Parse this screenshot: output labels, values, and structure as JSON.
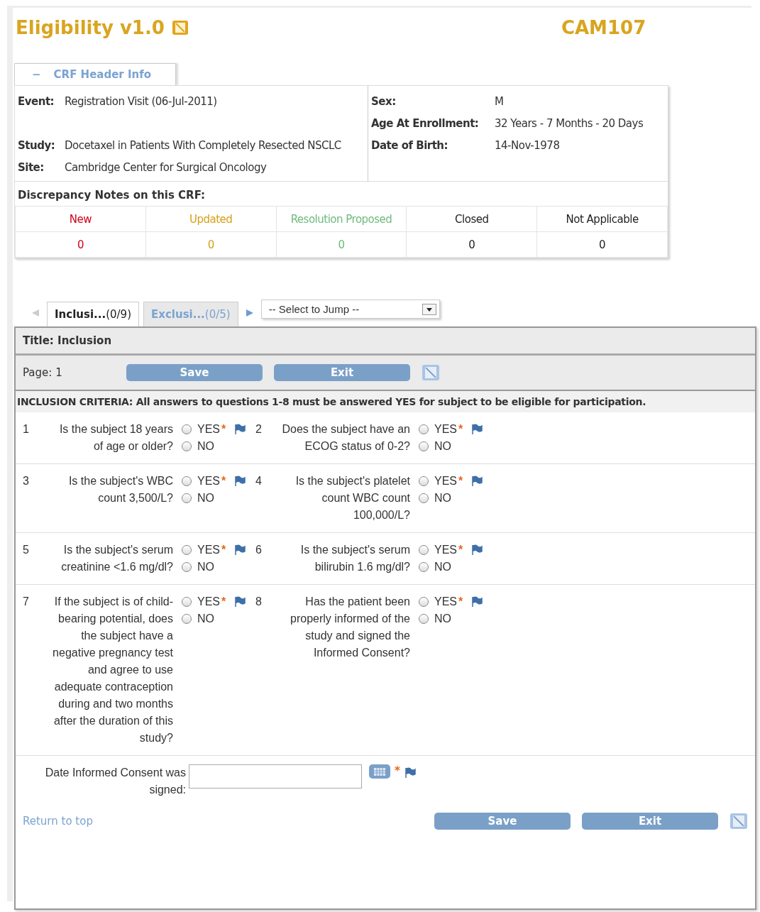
{
  "header": {
    "title": "Eligibility v1.0",
    "subject_id": "CAM107"
  },
  "crf_header": {
    "toggle": "−",
    "label": "CRF Header Info",
    "expanded": true,
    "left_fields": [
      {
        "label": "Event:",
        "value": "Registration Visit (06-Jul-2011)"
      },
      {
        "label": "Study:",
        "value": "Docetaxel in Patients With Completely Resected NSCLC"
      },
      {
        "label": "Site:",
        "value": "Cambridge Center for Surgical Oncology"
      }
    ],
    "right_fields": [
      {
        "label": "Sex:",
        "value": "M"
      },
      {
        "label": "Age At Enrollment:",
        "value": "32 Years - 7 Months - 20 Days"
      },
      {
        "label": "Date of Birth:",
        "value": "14-Nov-1978"
      }
    ],
    "notes_title": "Discrepancy Notes on this CRF:",
    "notes": [
      {
        "label": "New",
        "count": "0",
        "color": "#d0021b"
      },
      {
        "label": "Updated",
        "count": "0",
        "color": "#d4a017"
      },
      {
        "label": "Resolution Proposed",
        "count": "0",
        "color": "#6dbb7a"
      },
      {
        "label": "Closed",
        "count": "0",
        "color": "#222222"
      },
      {
        "label": "Not Applicable",
        "count": "0",
        "color": "#222222"
      }
    ]
  },
  "tabs": [
    {
      "label": "Inclusi...",
      "count": "(0/9)",
      "selected": true
    },
    {
      "label": "Exclusi...",
      "count": "(0/5)",
      "selected": false
    }
  ],
  "jump_select": {
    "value": "-- Select to Jump --"
  },
  "section": {
    "title": "Title: Inclusion",
    "page": "Page: 1",
    "save": "Save",
    "exit": "Exit",
    "instructions": "INCLUSION CRITERIA: All answers to questions 1-8 must be answered YES for subject to be eligible for participation.",
    "questions": [
      {
        "number": "1",
        "text": "Is the subject 18 years of age or older?",
        "required": "*",
        "options": [
          {
            "label": "YES",
            "checked": false
          },
          {
            "label": "NO",
            "checked": false
          }
        ]
      },
      {
        "number": "2",
        "text": "Does the subject have an ECOG status of 0-2?",
        "required": "*",
        "options": [
          {
            "label": "YES",
            "checked": false
          },
          {
            "label": "NO",
            "checked": false
          }
        ]
      },
      {
        "number": "3",
        "text": "Is the subject's WBC count 3,500/L?",
        "required": "*",
        "options": [
          {
            "label": "YES",
            "checked": false
          },
          {
            "label": "NO",
            "checked": false
          }
        ]
      },
      {
        "number": "4",
        "text": "Is the subject's platelet count WBC count 100,000/L?",
        "required": "*",
        "options": [
          {
            "label": "YES",
            "checked": false
          },
          {
            "label": "NO",
            "checked": false
          }
        ]
      },
      {
        "number": "5",
        "text": "Is the subject's serum creatinine <1.6 mg/dl?",
        "required": "*",
        "options": [
          {
            "label": "YES",
            "checked": false
          },
          {
            "label": "NO",
            "checked": false
          }
        ]
      },
      {
        "number": "6",
        "text": "Is the subject's serum bilirubin 1.6 mg/dl?",
        "required": "*",
        "options": [
          {
            "label": "YES",
            "checked": false
          },
          {
            "label": "NO",
            "checked": false
          }
        ]
      },
      {
        "number": "7",
        "text": "If the subject is of child-bearing potential, does the subject have a negative pregnancy test and agree to use adequate contraception during and two months after the duration of this study?",
        "required": "*",
        "options": [
          {
            "label": "YES",
            "checked": false
          },
          {
            "label": "NO",
            "checked": false
          }
        ]
      },
      {
        "number": "8",
        "text": "Has the patient been properly informed of the study and signed the Informed Consent?",
        "required": "*",
        "options": [
          {
            "label": "YES",
            "checked": false
          },
          {
            "label": "NO",
            "checked": false
          }
        ]
      }
    ],
    "date_field": {
      "label": "Date Informed Consent was signed:",
      "required": "*"
    },
    "return_link": "Return to top",
    "bottom_save": "Save",
    "bottom_exit": "Exit"
  }
}
